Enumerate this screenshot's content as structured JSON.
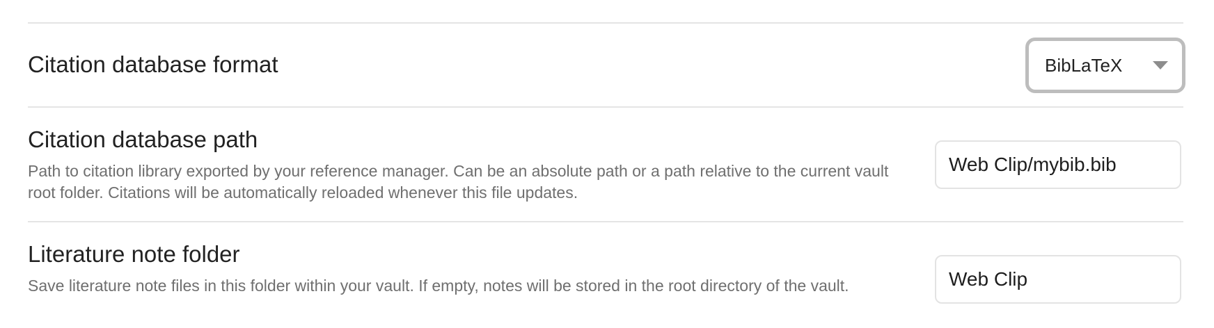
{
  "settings": {
    "citation_format": {
      "title": "Citation database format",
      "selected_value": "BibLaTeX"
    },
    "citation_path": {
      "title": "Citation database path",
      "description": "Path to citation library exported by your reference manager. Can be an absolute path or a path relative to the current vault root folder. Citations will be automatically reloaded whenever this file updates.",
      "value": "Web Clip/mybib.bib"
    },
    "literature_folder": {
      "title": "Literature note folder",
      "description": "Save literature note files in this folder within your vault. If empty, notes will be stored in the root directory of the vault.",
      "value": "Web Clip"
    }
  },
  "icons": {
    "dropdown": "chevron-down-icon"
  }
}
